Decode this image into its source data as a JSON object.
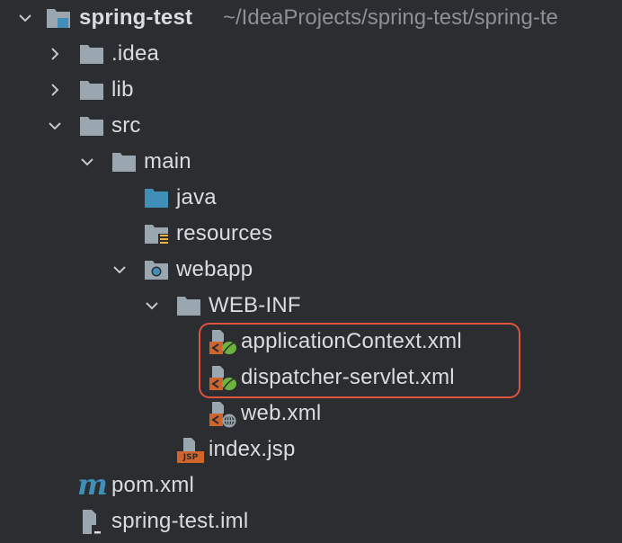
{
  "project": {
    "name": "spring-test",
    "path": "~/IdeaProjects/spring-test/spring-te"
  },
  "tree": {
    "idea": ".idea",
    "lib": "lib",
    "src": "src",
    "main": "main",
    "java": "java",
    "resources": "resources",
    "webapp": "webapp",
    "webinf": "WEB-INF",
    "appctx": "applicationContext.xml",
    "dispatcher": "dispatcher-servlet.xml",
    "webxml": "web.xml",
    "indexjsp": "index.jsp",
    "pom": "pom.xml",
    "iml": "spring-test.iml"
  },
  "icons": {
    "jsp_badge": "JSP",
    "pom_glyph": "m"
  },
  "colors": {
    "background": "#2b2d30",
    "folder": "#9aa7b0",
    "source_folder": "#3f8fb8",
    "spring_leaf": "#6db33f",
    "xml_badge": "#d0642b",
    "highlight": "#e0533f"
  }
}
